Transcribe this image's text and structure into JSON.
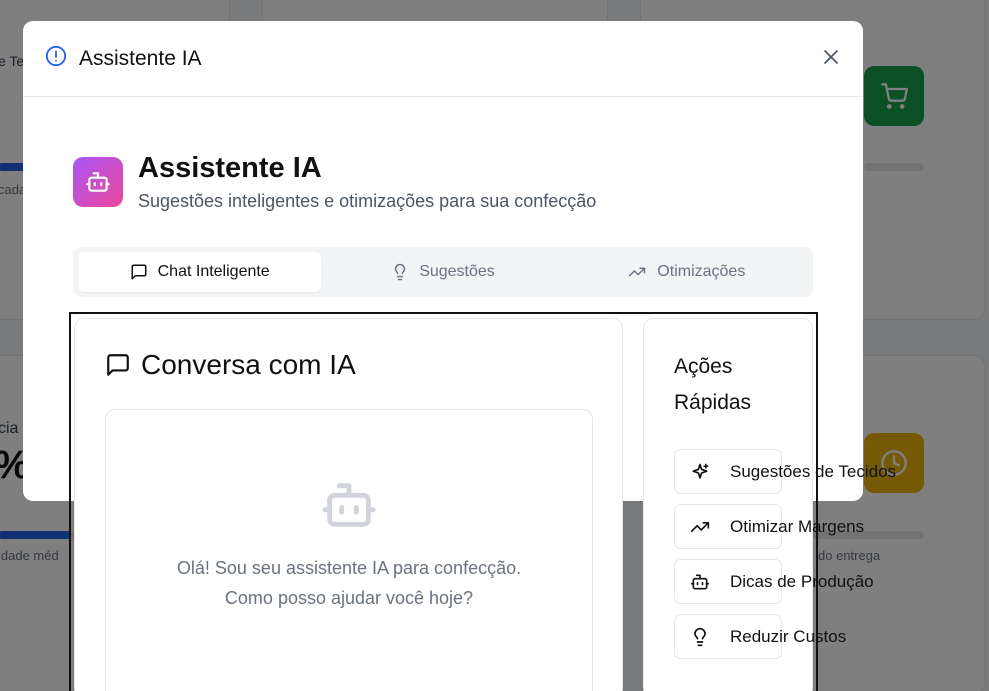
{
  "background": {
    "frag_top_left": "e Te",
    "frag_cada": "cada",
    "frag_cia": "cia",
    "frag_percent": "%",
    "frag_media": "idade méd",
    "frag_entrega": "do entrega"
  },
  "modal": {
    "title": "Assistente IA",
    "close_label": "×"
  },
  "app": {
    "title": "Assistente IA",
    "subtitle": "Sugestões inteligentes e otimizações para sua confecção"
  },
  "tabs": [
    {
      "label": "Chat Inteligente",
      "active": true
    },
    {
      "label": "Sugestões",
      "active": false
    },
    {
      "label": "Otimizações",
      "active": false
    }
  ],
  "chat": {
    "title": "Conversa com IA",
    "empty_line1": "Olá! Sou seu assistente IA para confecção.",
    "empty_line2": "Como posso ajudar você hoje?"
  },
  "quick_actions": {
    "title_line1": "Ações",
    "title_line2": "Rápidas",
    "items": [
      {
        "label": "Sugestões de Tecidos",
        "icon": "sparkles-icon"
      },
      {
        "label": "Otimizar Margens",
        "icon": "trending-up-icon"
      },
      {
        "label": "Dicas de Produção",
        "icon": "bot-icon"
      },
      {
        "label": "Reduzir Custos",
        "icon": "lightbulb-icon"
      }
    ]
  },
  "colors": {
    "accent_gradient_start": "#a855f7",
    "accent_gradient_end": "#ec4899",
    "cart_green": "#16a34a",
    "clock_yellow": "#eab308"
  }
}
